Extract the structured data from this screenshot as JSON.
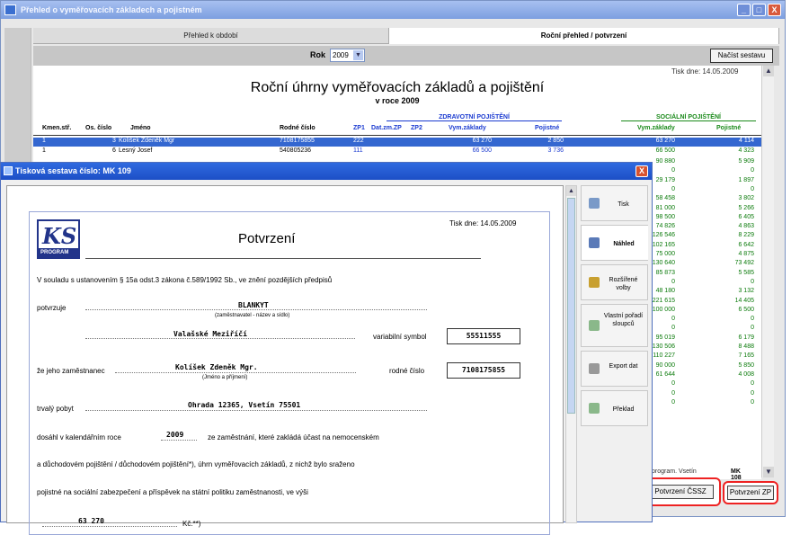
{
  "window": {
    "title": "Přehled o vyměřovacích základech a pojistném",
    "min": "_",
    "max": "□",
    "close": "X"
  },
  "tabs": [
    "Přehled k období",
    "Roční přehled / potvrzení"
  ],
  "toolbar": {
    "rok_label": "Rok",
    "rok_value": "2009",
    "nacist_label": "Načíst sestavu"
  },
  "report": {
    "tisk_dne": "Tisk dne: 14.05.2009",
    "title": "Roční úhrny vyměřovacích základů a pojištění",
    "subtitle": "v roce 2009",
    "section_zp": "ZDRAVOTNÍ POJIŠTĚNÍ",
    "section_sp": "SOCIÁLNÍ POJIŠTĚNÍ",
    "headers": [
      "Kmen.stř.",
      "Os. číslo",
      "Jméno",
      "Rodné číslo",
      "ZP1",
      "Dat.zm.ZP",
      "ZP2",
      "Vym.základy",
      "Pojistné",
      "Vym.základy",
      "Pojistné"
    ],
    "rows": [
      {
        "kmen": "1",
        "os": "3",
        "jmeno": "Kolíšek Zdeněk Mgr",
        "rc": "7108175855",
        "zp1": "222",
        "vz": "63 270",
        "poj": "2 850",
        "svz": "63 270",
        "spoj": "4 114"
      },
      {
        "kmen": "1",
        "os": "6",
        "jmeno": "Lesný Josef",
        "rc": "540805236",
        "zp1": "111",
        "vz": "66 500",
        "poj": "3 736",
        "svz": "66 500",
        "spoj": "4 323"
      }
    ],
    "social_rows": [
      [
        "90 880",
        "5 909"
      ],
      [
        "0",
        "0"
      ],
      [
        "29 179",
        "1 897"
      ],
      [
        "0",
        "0"
      ],
      [
        "58 458",
        "3 802"
      ],
      [
        "81 000",
        "5 266"
      ],
      [
        "98 500",
        "6 405"
      ],
      [
        "74 826",
        "4 863"
      ],
      [
        "126 546",
        "8 229"
      ],
      [
        "102 165",
        "6 642"
      ],
      [
        "75 000",
        "4 875"
      ],
      [
        "130 640",
        "73 492"
      ],
      [
        "85 873",
        "5 585"
      ],
      [
        "0",
        "0"
      ],
      [
        "48 180",
        "3 132"
      ],
      [
        "221 615",
        "14 405"
      ],
      [
        "100 000",
        "6 500"
      ],
      [
        "0",
        "0"
      ],
      [
        "0",
        "0"
      ],
      [
        "95 019",
        "6 179"
      ],
      [
        "130 506",
        "8 488"
      ],
      [
        "110 227",
        "7 165"
      ],
      [
        "90 000",
        "5 850"
      ],
      [
        "61 644",
        "4 008"
      ],
      [
        "0",
        "0"
      ],
      [
        "0",
        "0"
      ],
      [
        "0",
        "0"
      ]
    ],
    "status_text": "program. Vsetín",
    "status_code": "MK 108"
  },
  "buttons": {
    "potvrzeni_cssz": "Potvrzení ČSSZ",
    "potvrzeni_zp": "Potvrzení ZP"
  },
  "dialog": {
    "title": "Tisková sestava číslo:  MK 109",
    "close": "X",
    "logo_text": "KS",
    "logo_sub": "PROGRAM",
    "doc_title": "Potvrzení",
    "tisk_dne": "Tisk dne: 14.05.2009",
    "line1": "V souladu s ustanovením § 15a odst.3 zákona č.589/1992 Sb., ve znění pozdějších předpisů",
    "potvrzuje": "potvrzuje",
    "employer": "BLANKYT",
    "employer_note": "(zaměstnavatel - název a sídlo)",
    "city": "Valašské Meziříčí",
    "vs_label": "variabilní symbol",
    "vs_value": "55511555",
    "employee_label": "že jeho zaměstnanec",
    "employee": "Kolíšek Zdeněk Mgr.",
    "employee_note": "(Jméno a příjmení)",
    "rc_label": "rodné číslo",
    "rc_value": "7108175855",
    "pobyt_label": "trvalý pobyt",
    "pobyt": "Ohrada 12365, Vsetín 75501",
    "dosahl_label": "dosáhl v kalendářním roce",
    "year": "2009",
    "dosahl_rest": "ze zaměstnání, které zakládá účast na nemocenském",
    "line_a": "a důchodovém pojištění / důchodovém pojištění*), úhrn vyměřovacích základů, z nichž bylo sraženo",
    "line_b": "pojistné na sociální zabezpečení a příspěvek na státní politiku zaměstnanosti, ve výši",
    "amount": "63 270",
    "kc": "Kč.**)"
  },
  "side_buttons": [
    {
      "label": "Tisk",
      "icon": "printer-icon",
      "color": "#7a9ac8"
    },
    {
      "label": "Náhled",
      "icon": "preview-icon",
      "color": "#5a7ab8"
    },
    {
      "label": "Rozšířené volby",
      "icon": "options-icon",
      "color": "#c8a030"
    },
    {
      "label": "Vlastní pořadí sloupců",
      "icon": "columns-icon",
      "color": "#8ab88a"
    },
    {
      "label": "Export dat",
      "icon": "export-icon",
      "color": "#999999"
    },
    {
      "label": "Překlad",
      "icon": "translate-icon",
      "color": "#8ab88a"
    }
  ]
}
